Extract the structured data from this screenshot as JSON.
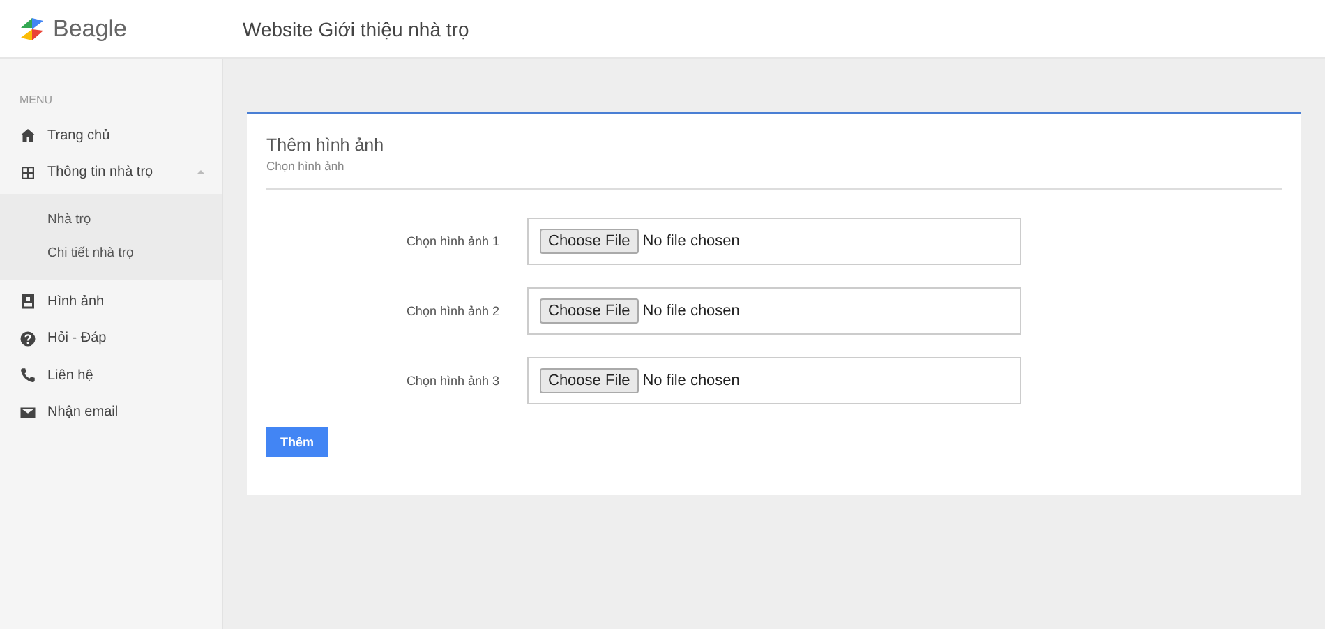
{
  "header": {
    "brand": "Beagle",
    "title": "Website Giới thiệu nhà trọ"
  },
  "sidebar": {
    "heading": "MENU",
    "items": [
      {
        "kind": "home",
        "label": "Trang chủ"
      },
      {
        "kind": "grid",
        "label": "Thông tin nhà trọ",
        "expanded": true,
        "children": [
          {
            "label": "Nhà trọ"
          },
          {
            "label": "Chi tiết nhà trọ"
          }
        ]
      },
      {
        "kind": "image",
        "label": "Hình ảnh"
      },
      {
        "kind": "help",
        "label": "Hỏi - Đáp"
      },
      {
        "kind": "phone",
        "label": "Liên hệ"
      },
      {
        "kind": "mail",
        "label": "Nhận email"
      }
    ]
  },
  "card": {
    "title": "Thêm hình ảnh",
    "subtitle": "Chọn hình ảnh",
    "fields": [
      {
        "label": "Chọn hình ảnh 1",
        "button": "Choose File",
        "value": "No file chosen"
      },
      {
        "label": "Chọn hình ảnh 2",
        "button": "Choose File",
        "value": "No file chosen"
      },
      {
        "label": "Chọn hình ảnh 3",
        "button": "Choose File",
        "value": "No file chosen"
      }
    ],
    "submit": "Thêm"
  }
}
